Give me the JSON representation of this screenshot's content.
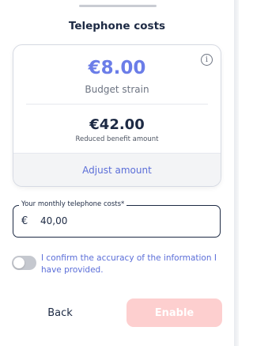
{
  "header": {
    "title": "Telephone costs"
  },
  "summary": {
    "budget_strain_amount": "€8.00",
    "budget_strain_label": "Budget strain",
    "reduced_benefit_amount": "€42.00",
    "reduced_benefit_label": "Reduced benefit amount",
    "adjust_label": "Adjust amount",
    "info_icon": "info-icon"
  },
  "phone_cost_field": {
    "label": "Your monthly telephone costs*",
    "currency_symbol": "€",
    "value": "40,00"
  },
  "confirmation": {
    "checked": false,
    "text": "I confirm the accuracy of the information I have provided."
  },
  "actions": {
    "back_label": "Back",
    "enable_label": "Enable",
    "enable_disabled": true
  },
  "colors": {
    "accent": "#6b7de8",
    "link": "#5b6ed8",
    "text_dark": "#1d2a44",
    "enable_disabled_bg": "#fdcfcf"
  }
}
